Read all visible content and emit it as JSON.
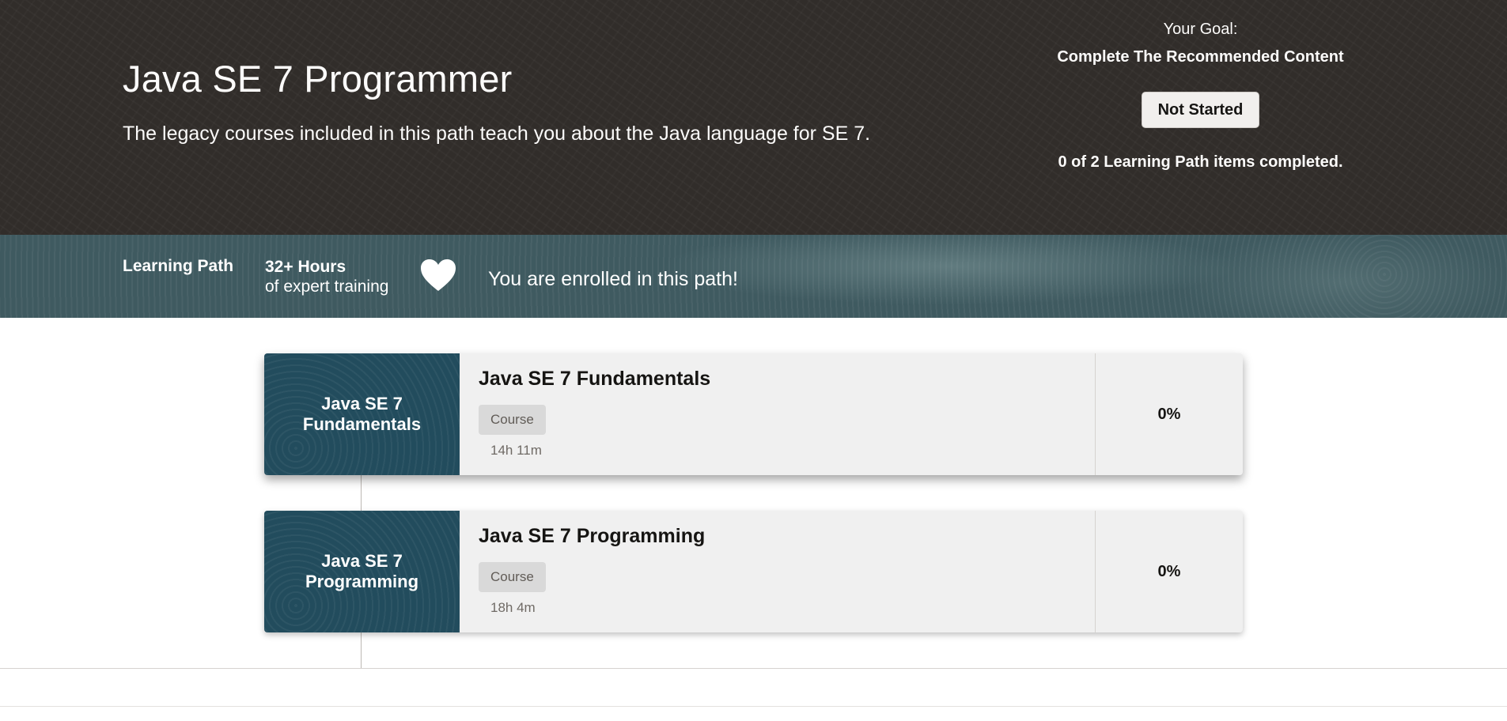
{
  "hero": {
    "title": "Java SE 7 Programmer",
    "description": "The legacy courses included in this path teach you about the Java language for SE 7.",
    "goal_label": "Your Goal:",
    "goal_value": "Complete The Recommended Content",
    "status_button": "Not Started",
    "progress_text": "0 of 2 Learning Path items completed."
  },
  "band": {
    "type": "Learning Path",
    "hours": "32+ Hours",
    "hours_sub": "of expert training",
    "favorite_icon": "heart-icon",
    "enrolled_text": "You are enrolled in this path!"
  },
  "courses": [
    {
      "thumb_line1": "Java SE 7",
      "thumb_line2": "Fundamentals",
      "title": "Java SE 7 Fundamentals",
      "type": "Course",
      "duration": "14h 11m",
      "percent": "0%"
    },
    {
      "thumb_line1": "Java SE 7",
      "thumb_line2": "Programming",
      "title": "Java SE 7 Programming",
      "type": "Course",
      "duration": "18h 4m",
      "percent": "0%"
    }
  ],
  "colors": {
    "hero_bg": "#312d2a",
    "band_bg": "#3f5a60",
    "thumb_bg": "#224c5d",
    "card_bg": "#f0f0f0"
  }
}
